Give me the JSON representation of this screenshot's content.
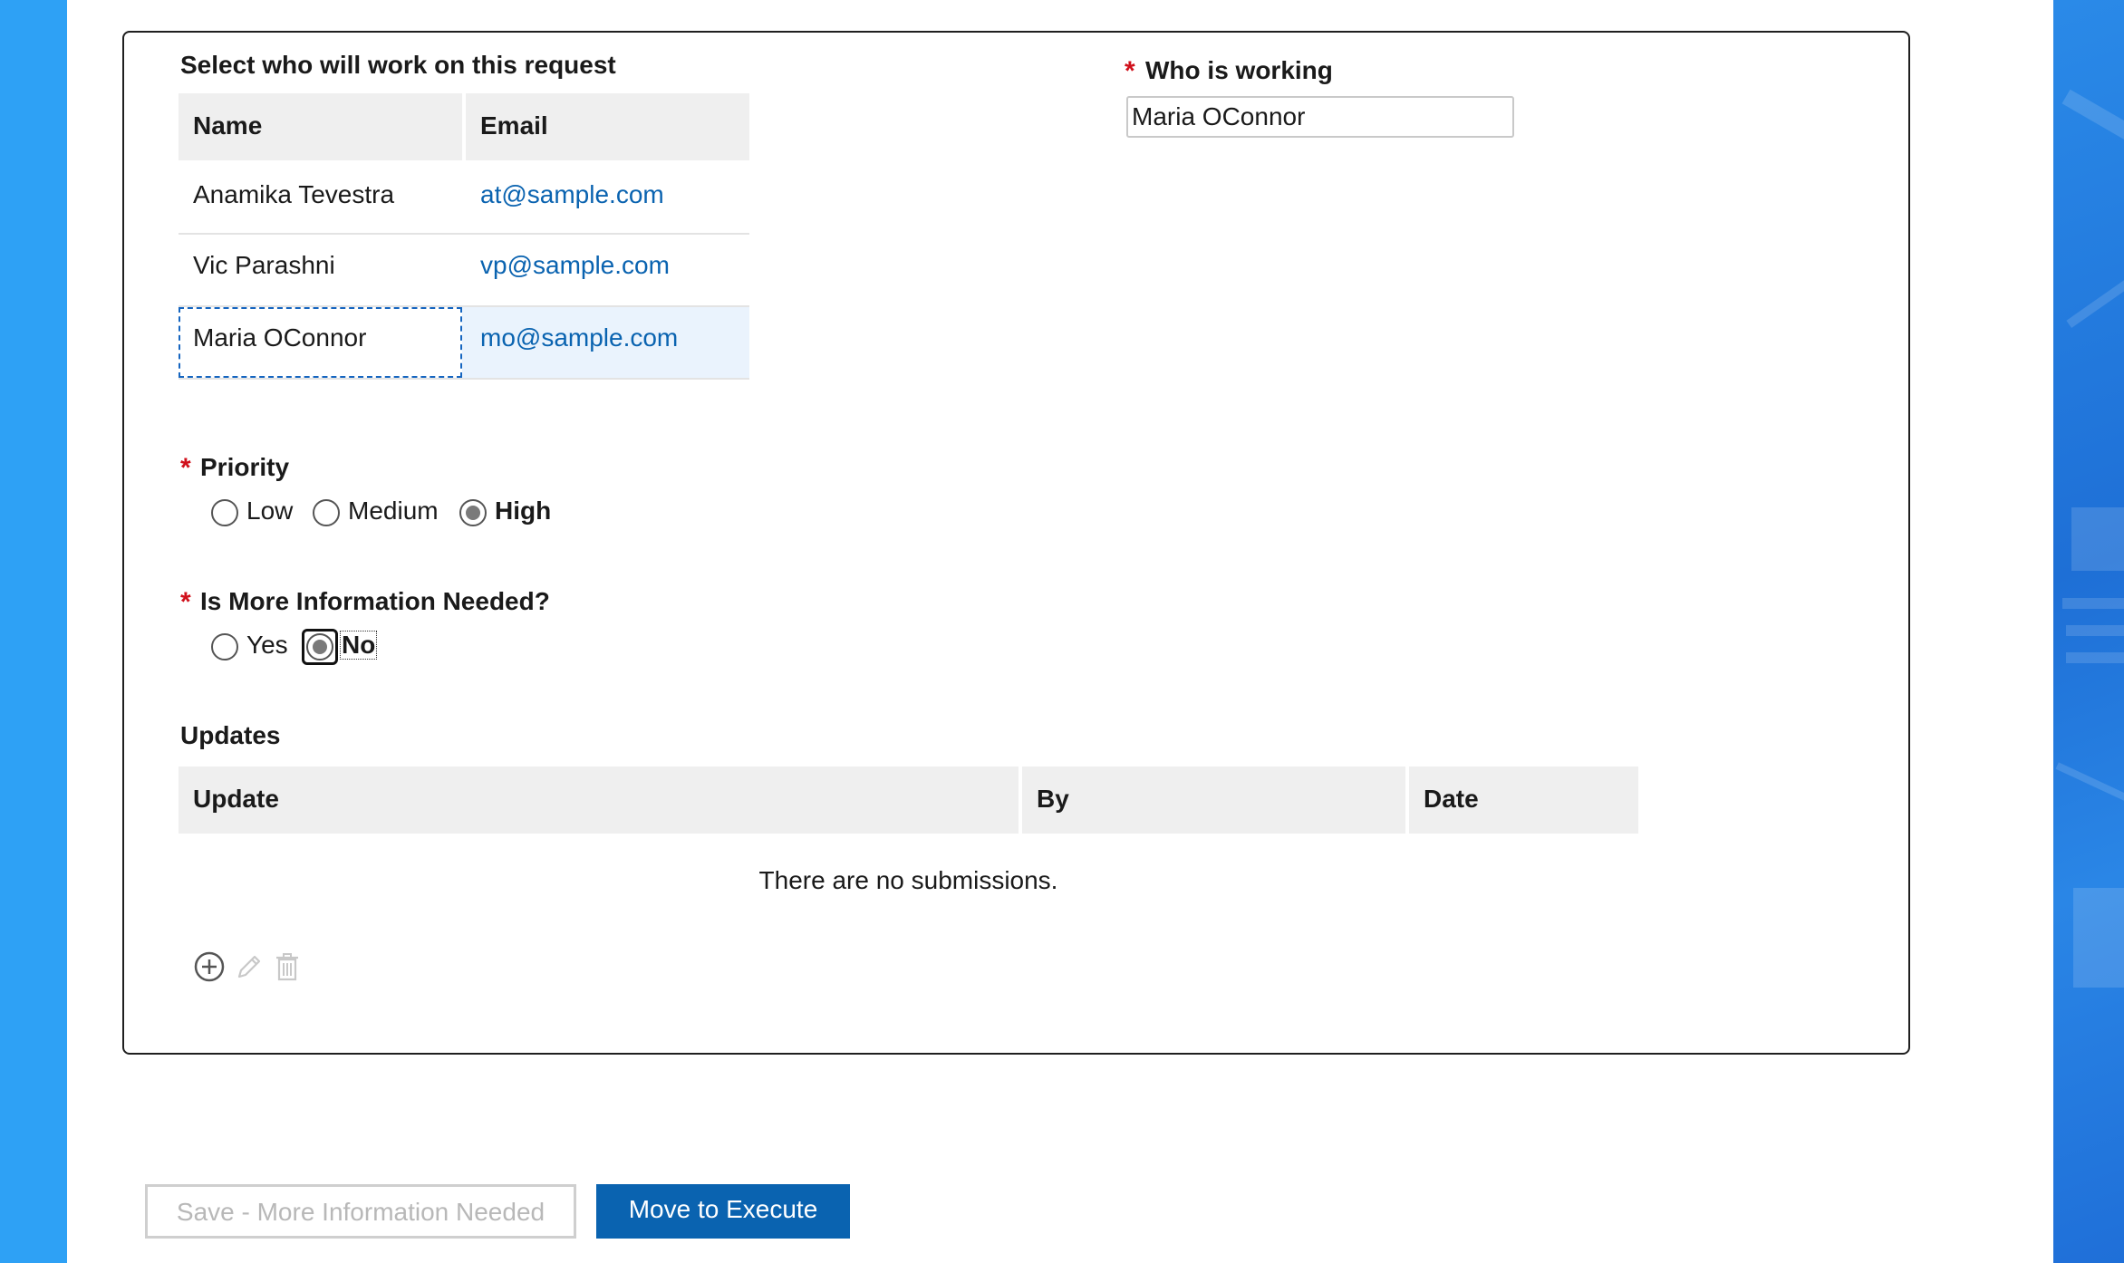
{
  "colors": {
    "accent": "#0a63b0",
    "left_band": "#2ea1f5",
    "required": "#d0101b",
    "header_bg": "#efefef",
    "selected_row_bg": "#eaf3fd"
  },
  "worker_table": {
    "title": "Select who will work on this request",
    "headers": [
      "Name",
      "Email"
    ],
    "rows": [
      {
        "name": "Anamika Tevestra",
        "email": "at@sample.com"
      },
      {
        "name": "Vic Parashni",
        "email": "vp@sample.com"
      },
      {
        "name": "Maria OConnor",
        "email": "mo@sample.com"
      }
    ]
  },
  "who_working": {
    "required_mark": "*",
    "label": "Who is working",
    "value": "Maria OConnor"
  },
  "priority": {
    "required_mark": "*",
    "label": "Priority",
    "options": [
      "Low",
      "Medium",
      "High"
    ],
    "selected": "High"
  },
  "more_info": {
    "required_mark": "*",
    "label": "Is More Information Needed?",
    "options": [
      "Yes",
      "No"
    ],
    "selected": "No"
  },
  "updates": {
    "title": "Updates",
    "headers": [
      "Update",
      "By",
      "Date"
    ],
    "empty_text": "There are no submissions.",
    "toolbar_icons": [
      "add-circle-icon",
      "pencil-icon",
      "trash-icon"
    ]
  },
  "buttons": {
    "save_label": "Save - More Information Needed",
    "move_label": "Move to Execute"
  }
}
